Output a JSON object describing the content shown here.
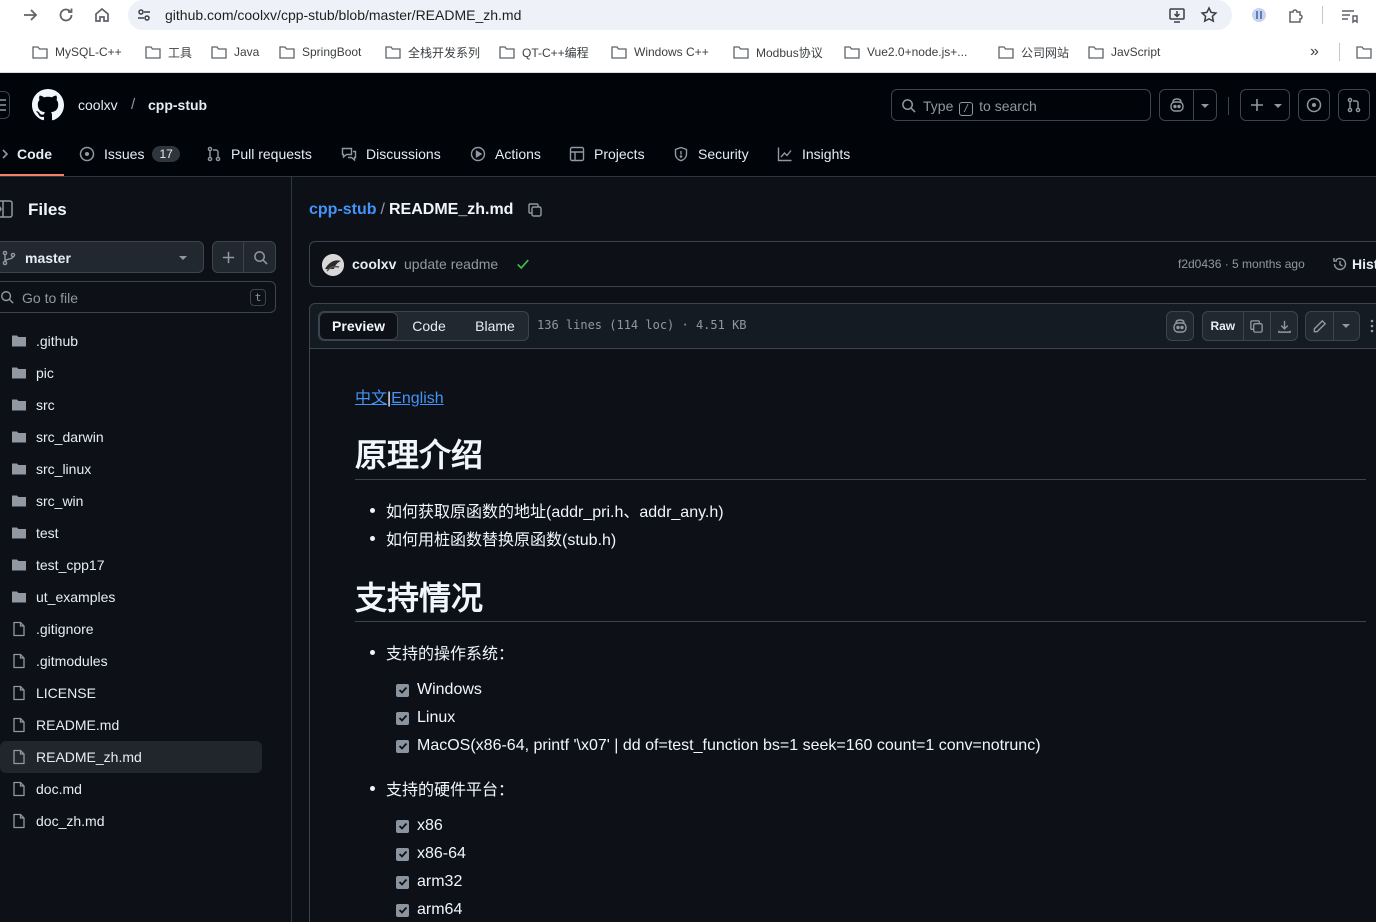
{
  "browser": {
    "url": "github.com/coolxv/cpp-stub/blob/master/README_zh.md",
    "bookmarks": [
      "MySQL-C++",
      "工具",
      "Java",
      "SpringBoot",
      "全栈开发系列",
      "QT-C++编程",
      "Windows C++",
      "Modbus协议",
      "Vue2.0+node.js+...",
      "公司网站",
      "JavScript"
    ],
    "overflow_label": "»"
  },
  "header": {
    "owner": "coolxv",
    "separator": "/",
    "repo": "cpp-stub",
    "search_prefix": "Type",
    "search_key": "/",
    "search_suffix": "to search"
  },
  "repo_tabs": [
    {
      "label": "Code",
      "icon": "code-icon"
    },
    {
      "label": "Issues",
      "icon": "issue-icon",
      "count": "17"
    },
    {
      "label": "Pull requests",
      "icon": "pull-request-icon"
    },
    {
      "label": "Discussions",
      "icon": "discussion-icon"
    },
    {
      "label": "Actions",
      "icon": "play-icon"
    },
    {
      "label": "Projects",
      "icon": "table-icon"
    },
    {
      "label": "Security",
      "icon": "shield-icon"
    },
    {
      "label": "Insights",
      "icon": "graph-icon"
    }
  ],
  "sidebar": {
    "title": "Files",
    "branch": "master",
    "go_to_file_placeholder": "Go to file",
    "go_to_file_key": "t",
    "items": [
      {
        "name": ".github",
        "type": "folder"
      },
      {
        "name": "pic",
        "type": "folder"
      },
      {
        "name": "src",
        "type": "folder"
      },
      {
        "name": "src_darwin",
        "type": "folder"
      },
      {
        "name": "src_linux",
        "type": "folder"
      },
      {
        "name": "src_win",
        "type": "folder"
      },
      {
        "name": "test",
        "type": "folder"
      },
      {
        "name": "test_cpp17",
        "type": "folder"
      },
      {
        "name": "ut_examples",
        "type": "folder"
      },
      {
        "name": ".gitignore",
        "type": "file"
      },
      {
        "name": ".gitmodules",
        "type": "file"
      },
      {
        "name": "LICENSE",
        "type": "file"
      },
      {
        "name": "README.md",
        "type": "file"
      },
      {
        "name": "README_zh.md",
        "type": "file",
        "selected": true
      },
      {
        "name": "doc.md",
        "type": "file"
      },
      {
        "name": "doc_zh.md",
        "type": "file"
      }
    ]
  },
  "file": {
    "breadcrumb_repo": "cpp-stub",
    "breadcrumb_sep": "/",
    "filename": "README_zh.md",
    "commit_author": "coolxv",
    "commit_message": "update readme",
    "commit_meta": "f2d0436 · 5 months ago",
    "history_label": "Hist",
    "view_tabs": [
      "Preview",
      "Code",
      "Blame"
    ],
    "stats": "136 lines (114 loc) · 4.51 KB",
    "raw_label": "Raw"
  },
  "readme": {
    "lang_zh": "中文",
    "lang_sep": "|",
    "lang_en": "English",
    "h1_principle": "原理介绍",
    "principle_items": [
      "如何获取原函数的地址(addr_pri.h、addr_any.h)",
      "如何用桩函数替换原函数(stub.h)"
    ],
    "h1_support": "支持情况",
    "os_label": "支持的操作系统：",
    "os_items": [
      "Windows",
      "Linux",
      "MacOS(x86-64, printf '\\x07' | dd of=test_function bs=1 seek=160 count=1 conv=notrunc)"
    ],
    "hw_label": "支持的硬件平台：",
    "hw_items": [
      "x86",
      "x86-64",
      "arm32",
      "arm64"
    ]
  },
  "colors": {
    "accent_link": "#4493f8",
    "tab_underline": "#f78166",
    "success": "#3fb950"
  }
}
